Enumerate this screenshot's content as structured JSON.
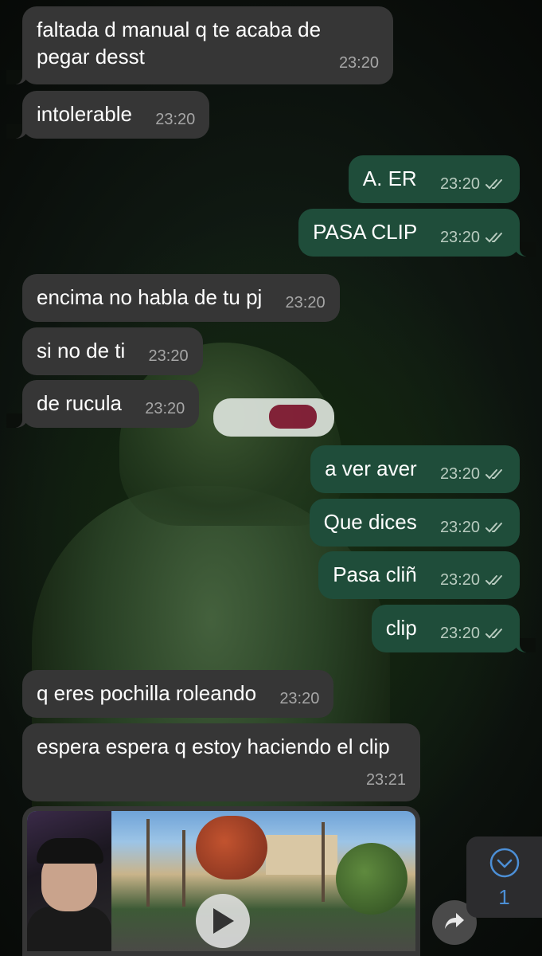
{
  "messages": [
    {
      "text": "faltada d manual q te acaba de pegar desst",
      "time": "23:20",
      "direction": "incoming"
    },
    {
      "text": "intolerable",
      "time": "23:20",
      "direction": "incoming"
    },
    {
      "text": "A. ER",
      "time": "23:20",
      "direction": "outgoing",
      "status": "read"
    },
    {
      "text": "PASA CLIP",
      "time": "23:20",
      "direction": "outgoing",
      "status": "read"
    },
    {
      "text": "encima no habla de tu pj",
      "time": "23:20",
      "direction": "incoming"
    },
    {
      "text": "si no de ti",
      "time": "23:20",
      "direction": "incoming"
    },
    {
      "text": "de rucula",
      "time": "23:20",
      "direction": "incoming"
    },
    {
      "text": "a ver aver",
      "time": "23:20",
      "direction": "outgoing",
      "status": "read"
    },
    {
      "text": "Que dices",
      "time": "23:20",
      "direction": "outgoing",
      "status": "read"
    },
    {
      "text": "Pasa cliñ",
      "time": "23:20",
      "direction": "outgoing",
      "status": "read"
    },
    {
      "text": "clip",
      "time": "23:20",
      "direction": "outgoing",
      "status": "read"
    },
    {
      "text": "q eres pochilla roleando",
      "time": "23:20",
      "direction": "incoming"
    },
    {
      "text": "espera espera q estoy haciendo el clip",
      "time": "23:21",
      "direction": "incoming"
    }
  ],
  "media_message": {
    "type": "video",
    "icon": "play-icon",
    "direction": "incoming"
  },
  "share_button": {
    "icon": "share-arrow-icon"
  },
  "scroll_down": {
    "icon": "chevron-down-icon",
    "unread_count": "1"
  },
  "colors": {
    "incoming_bubble": "#363636",
    "outgoing_bubble": "#1f4d3a",
    "text": "#ffffff",
    "timestamp": "#a6a6a6",
    "accent": "#4c8fd6"
  }
}
